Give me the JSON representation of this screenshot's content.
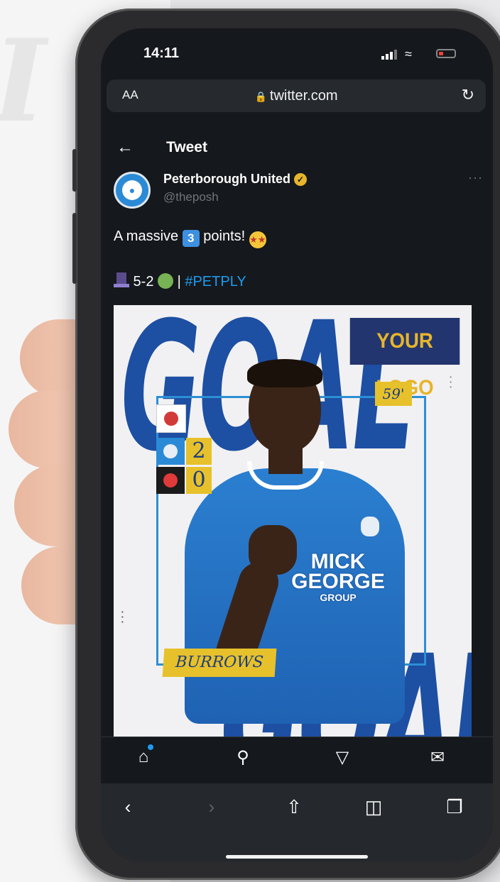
{
  "status_bar": {
    "time": "14:11"
  },
  "browser": {
    "text_size_label": "AA",
    "url": "twitter.com"
  },
  "tweet_header": {
    "title": "Tweet"
  },
  "author": {
    "name": "Peterborough United",
    "handle": "@theposh"
  },
  "tweet": {
    "line1_prefix": "A massive ",
    "number_emoji": "3",
    "line1_suffix": " points! ",
    "line2_score": " 5-2 ",
    "line2_sep": " | ",
    "hashtag": "#PETPLY"
  },
  "media": {
    "top_word": "GOAL",
    "bottom_word": "GOAL",
    "logo_text": "YOUR LOGO",
    "minute": "59'",
    "home_score": "2",
    "away_score": "0",
    "sponsor_line1": "MICK",
    "sponsor_line2": "GEORGE",
    "sponsor_line3": "GROUP",
    "player_name": "BURROWS"
  },
  "colors": {
    "accent_blue": "#1d9bf0",
    "posh_blue": "#1d4fa3",
    "gold": "#e7c12b",
    "navy": "#23356e"
  },
  "icons": {
    "tab_bar": [
      "home-icon",
      "search-icon",
      "bell-icon",
      "mail-icon"
    ],
    "toolbar": [
      "back-icon",
      "forward-icon",
      "share-icon",
      "bookmarks-icon",
      "tabs-icon"
    ]
  }
}
